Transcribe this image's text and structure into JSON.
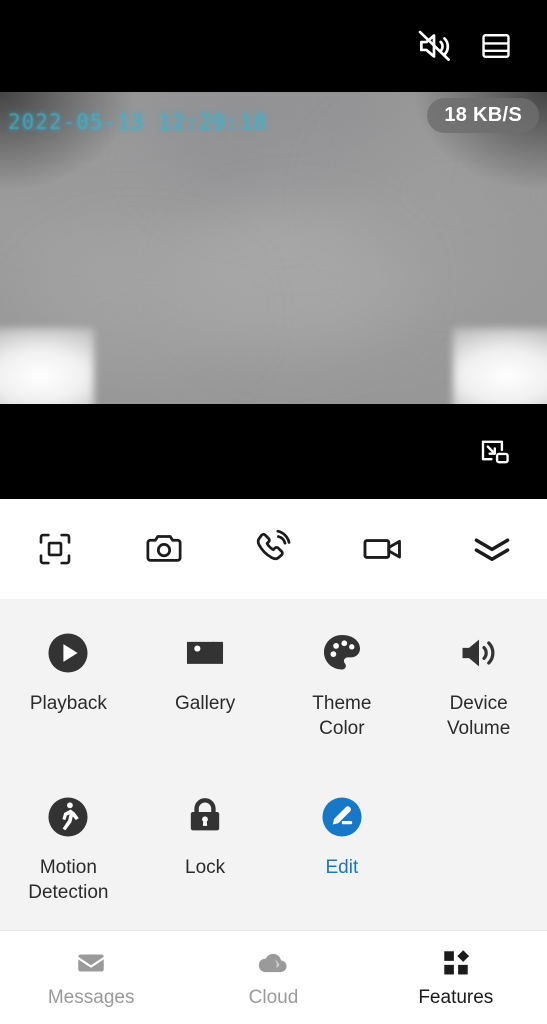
{
  "header": {
    "icons": [
      {
        "name": "mute-icon",
        "label": "Mute"
      },
      {
        "name": "split-view-icon",
        "label": "Split View"
      }
    ]
  },
  "video": {
    "timestamp": "2022-05-13 12:29:18",
    "bitrate": "18 KB/S",
    "pip_label": "Picture in Picture"
  },
  "toolbar": {
    "items": [
      {
        "name": "fullscreen-icon",
        "label": "Fullscreen"
      },
      {
        "name": "snapshot-icon",
        "label": "Snapshot"
      },
      {
        "name": "intercom-icon",
        "label": "Intercom"
      },
      {
        "name": "record-icon",
        "label": "Record"
      },
      {
        "name": "expand-icon",
        "label": "Expand"
      }
    ]
  },
  "features": {
    "row1": [
      {
        "label": "Playback",
        "icon": "play-circle-icon",
        "accent": false
      },
      {
        "label": "Gallery",
        "icon": "gallery-icon",
        "accent": false
      },
      {
        "label": "Theme\nColor",
        "icon": "palette-icon",
        "accent": false
      },
      {
        "label": "Device\nVolume",
        "icon": "volume-icon",
        "accent": false
      }
    ],
    "row2": [
      {
        "label": "Motion\nDetection",
        "icon": "motion-detection-icon",
        "accent": false
      },
      {
        "label": "Lock",
        "icon": "lock-icon",
        "accent": false
      },
      {
        "label": "Edit",
        "icon": "edit-pencil-icon",
        "accent": true
      }
    ]
  },
  "bottom_nav": {
    "items": [
      {
        "label": "Messages",
        "icon": "envelope-icon",
        "active": false
      },
      {
        "label": "Cloud",
        "icon": "cloud-icon",
        "active": false
      },
      {
        "label": "Features",
        "icon": "grid-icon",
        "active": true
      }
    ]
  },
  "colors": {
    "accent": "#1878c8",
    "icon_dark": "#333333",
    "panel_bg": "#f3f3f3",
    "timestamp": "#3ab3cf",
    "nav_inactive": "#9a9a9a"
  }
}
